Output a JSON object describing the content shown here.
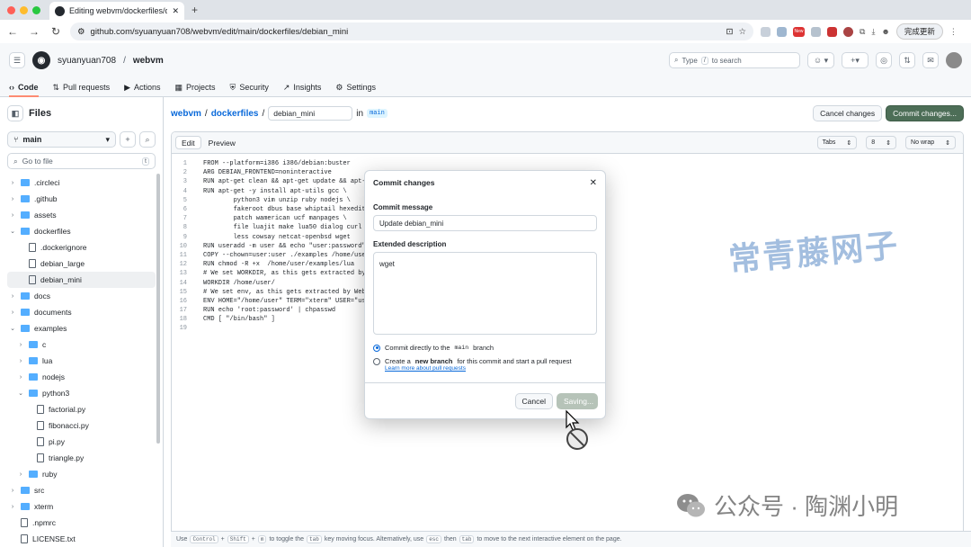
{
  "browser": {
    "tab_title": "Editing webvm/dockerfiles/de",
    "new_tab": "+",
    "url": "github.com/syuanyuan708/webvm/edit/main/dockerfiles/debian_mini",
    "update_button": "完成更新",
    "new_badge": "New"
  },
  "github": {
    "owner": "syuanyuan708",
    "separator": "/",
    "repo": "webvm",
    "search_placeholder_prefix": "Type",
    "search_key": "/",
    "search_placeholder_suffix": "to search",
    "plus": "+",
    "tabs": [
      {
        "label": "Code",
        "icon": "code-icon"
      },
      {
        "label": "Pull requests",
        "icon": "pull-request-icon"
      },
      {
        "label": "Actions",
        "icon": "actions-icon"
      },
      {
        "label": "Projects",
        "icon": "projects-icon"
      },
      {
        "label": "Security",
        "icon": "shield-icon"
      },
      {
        "label": "Insights",
        "icon": "graph-icon"
      },
      {
        "label": "Settings",
        "icon": "gear-icon"
      }
    ]
  },
  "sidebar": {
    "title": "Files",
    "branch": "main",
    "goto_placeholder": "Go to file",
    "goto_key": "t",
    "items": [
      {
        "label": ".circleci",
        "type": "folder",
        "depth": 0,
        "open": false
      },
      {
        "label": ".github",
        "type": "folder",
        "depth": 0,
        "open": false
      },
      {
        "label": "assets",
        "type": "folder",
        "depth": 0,
        "open": false
      },
      {
        "label": "dockerfiles",
        "type": "folder",
        "depth": 0,
        "open": true
      },
      {
        "label": ".dockerignore",
        "type": "file",
        "depth": 1
      },
      {
        "label": "debian_large",
        "type": "file",
        "depth": 1
      },
      {
        "label": "debian_mini",
        "type": "file",
        "depth": 1,
        "selected": true
      },
      {
        "label": "docs",
        "type": "folder",
        "depth": 0,
        "open": false
      },
      {
        "label": "documents",
        "type": "folder",
        "depth": 0,
        "open": false
      },
      {
        "label": "examples",
        "type": "folder",
        "depth": 0,
        "open": true
      },
      {
        "label": "c",
        "type": "folder",
        "depth": 1,
        "open": false
      },
      {
        "label": "lua",
        "type": "folder",
        "depth": 1,
        "open": false
      },
      {
        "label": "nodejs",
        "type": "folder",
        "depth": 1,
        "open": false
      },
      {
        "label": "python3",
        "type": "folder",
        "depth": 1,
        "open": true
      },
      {
        "label": "factorial.py",
        "type": "file",
        "depth": 2
      },
      {
        "label": "fibonacci.py",
        "type": "file",
        "depth": 2
      },
      {
        "label": "pi.py",
        "type": "file",
        "depth": 2
      },
      {
        "label": "triangle.py",
        "type": "file",
        "depth": 2
      },
      {
        "label": "ruby",
        "type": "folder",
        "depth": 1,
        "open": false
      },
      {
        "label": "src",
        "type": "folder",
        "depth": 0,
        "open": false
      },
      {
        "label": "xterm",
        "type": "folder",
        "depth": 0,
        "open": false
      },
      {
        "label": ".npmrc",
        "type": "file",
        "depth": 0
      },
      {
        "label": "LICENSE.txt",
        "type": "file",
        "depth": 0
      }
    ]
  },
  "editor": {
    "path_repo": "webvm",
    "path_sep": "/",
    "path_dir": "dockerfiles",
    "filename": "debian_mini",
    "in_label": "in",
    "branch": "main",
    "cancel_label": "Cancel changes",
    "commit_label": "Commit changes...",
    "tab_edit": "Edit",
    "tab_preview": "Preview",
    "indent_mode": "Tabs",
    "indent_size": "8",
    "wrap_mode": "No wrap",
    "lines": [
      "FROM --platform=i386 i386/debian:buster",
      "ARG DEBIAN_FRONTEND=noninteractive",
      "RUN apt-get clean && apt-get update && apt-g",
      "RUN apt-get -y install apt-utils gcc \\",
      "        python3 vim unzip ruby nodejs \\",
      "        fakeroot dbus base whiptail hexedit",
      "        patch wamerican ucf manpages \\",
      "        file luajit make lua50 dialog curl \\",
      "        less cowsay netcat-openbsd wget",
      "RUN useradd -m user && echo \"user:password\"",
      "COPY --chown=user:user ./examples /home/user",
      "RUN chmod -R +x  /home/user/examples/lua",
      "# We set WORKDIR, as this gets extracted by W",
      "WORKDIR /home/user/",
      "# We set env, as this gets extracted by Webv",
      "ENV HOME=\"/home/user\" TERM=\"xterm\" USER=\"use",
      "RUN echo 'root:password' | chpasswd",
      "CMD [ \"/bin/bash\" ]",
      ""
    ]
  },
  "footer": {
    "t1": "Use",
    "k1": "Control",
    "p1": "+",
    "k2": "Shift",
    "p2": "+",
    "k3": "m",
    "t2": "to toggle the",
    "k4": "tab",
    "t3": "key moving focus. Alternatively, use",
    "k5": "esc",
    "t4": "then",
    "k6": "tab",
    "t5": "to move to the next interactive element on the page."
  },
  "modal": {
    "title": "Commit changes",
    "message_label": "Commit message",
    "message_value": "Update debian_mini",
    "description_label": "Extended description",
    "description_value": "wget",
    "option1_prefix": "Commit directly to the",
    "option1_branch": "main",
    "option1_suffix": "branch",
    "option2_prefix": "Create a",
    "option2_bold": "new branch",
    "option2_suffix": "for this commit and start a pull request",
    "learn_more": "Learn more about pull requests",
    "cancel_label": "Cancel",
    "saving_label": "Saving..."
  },
  "watermarks": {
    "stamp": "常青藤网子",
    "account": "公众号 · 陶渊小明"
  },
  "colors": {
    "commit_button": "#4d6e57",
    "link": "#0969da",
    "active_tab_underline": "#fd8c73"
  }
}
